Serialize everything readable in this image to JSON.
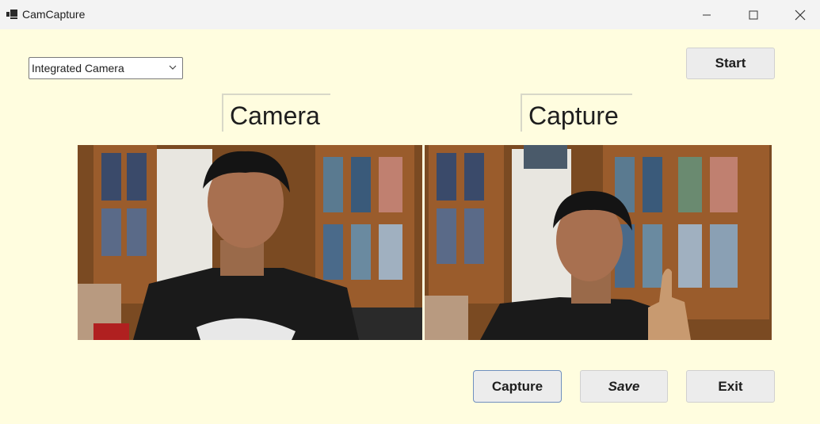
{
  "window": {
    "title": "CamCapture"
  },
  "camera_select": {
    "value": "Integrated Camera"
  },
  "buttons": {
    "start": "Start",
    "capture": "Capture",
    "save": "Save",
    "exit": "Exit"
  },
  "labels": {
    "camera": "Camera",
    "capture": "Capture"
  },
  "colors": {
    "client_bg": "#fffddf",
    "titlebar_bg": "#f3f3f3",
    "button_bg": "#ececec"
  }
}
